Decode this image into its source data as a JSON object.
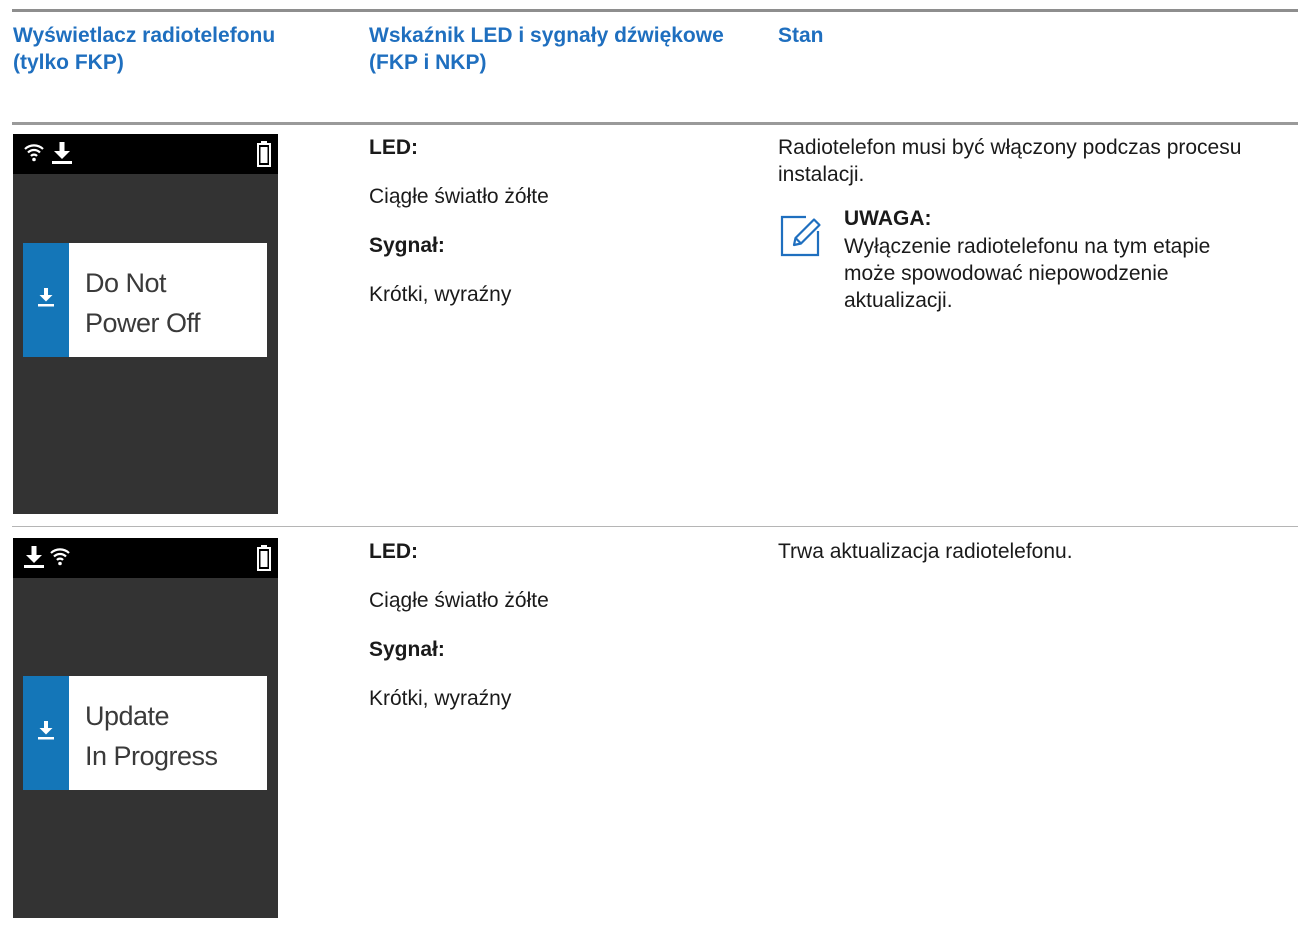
{
  "table": {
    "headers": [
      "Wyświetlacz radiotelefonu (tylko FKP)",
      "Wskaźnik LED i sygnały dźwiękowe (FKP i NKP)",
      "Stan"
    ],
    "rows": [
      {
        "screen": {
          "icons": [
            "wifi-icon",
            "download-icon",
            "battery-icon"
          ],
          "lines": [
            "Do Not",
            "Power Off"
          ]
        },
        "led_label": "LED:",
        "led_value": "Ciągłe światło żółte",
        "signal_label": "Sygnał:",
        "signal_value": "Krótki, wyraźny",
        "status": "Radiotelefon musi być włączony podczas procesu instalacji.",
        "note": {
          "title": "UWAGA:",
          "body": "Wyłączenie radiotelefonu na tym etapie może spowodować niepowodzenie aktualizacji."
        }
      },
      {
        "screen": {
          "icons": [
            "download-icon",
            "wifi-icon",
            "battery-icon"
          ],
          "lines": [
            "Update",
            "In Progress"
          ]
        },
        "led_label": "LED:",
        "led_value": "Ciągłe światło żółte",
        "signal_label": "Sygnał:",
        "signal_value": "Krótki, wyraźny",
        "status": "Trwa aktualizacja radiotelefonu."
      }
    ]
  },
  "colors": {
    "header_text": "#1f6fbf",
    "screen_bg": "#333333",
    "status_bar": "#000000",
    "accent_bar": "#1476b8"
  }
}
